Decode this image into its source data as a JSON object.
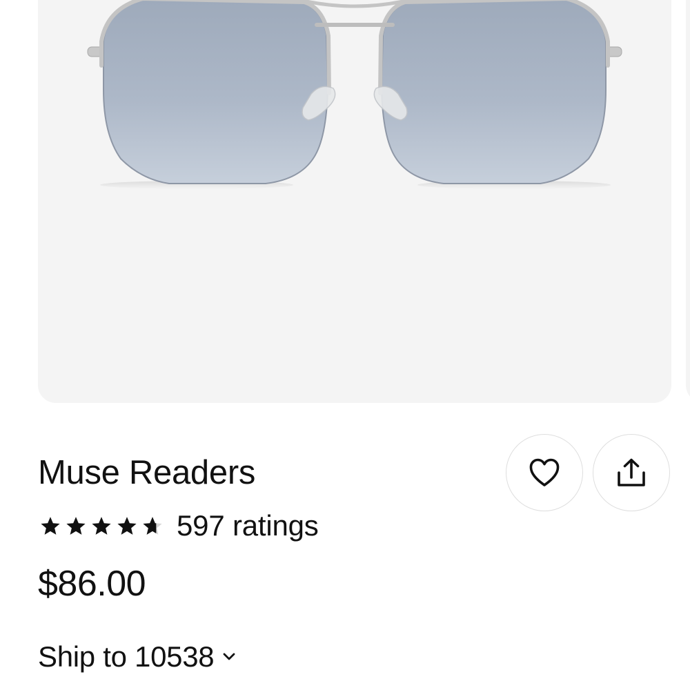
{
  "product": {
    "title": "Muse Readers",
    "rating": {
      "stars": 4.7,
      "max_stars": 5,
      "count_label": "597 ratings"
    },
    "price": "$86.00"
  },
  "shipping": {
    "label": "Ship to 10538"
  },
  "icons": {
    "favorite": "heart-icon",
    "share": "share-icon",
    "shipping_dropdown": "chevron-down-icon"
  },
  "colors": {
    "image_background": "#f4f4f4",
    "lens_tint": "#a9b3c2",
    "frame_metal": "#c4c4c4",
    "temple_dark": "#2c3038",
    "text": "#111111"
  }
}
